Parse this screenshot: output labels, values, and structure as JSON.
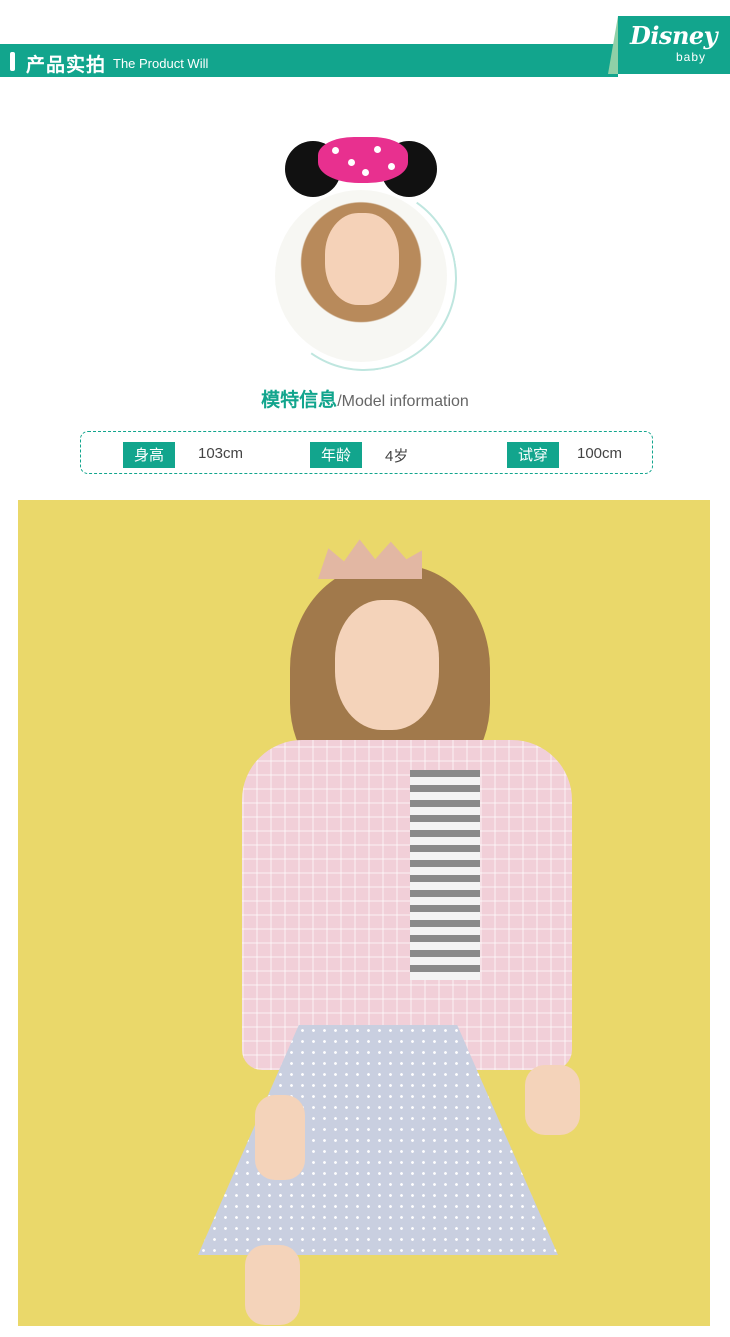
{
  "header": {
    "title": "产品实拍",
    "subtitle": "The Product Will",
    "brand": "Disney",
    "brand_sub": "baby",
    "color": "#12a58d"
  },
  "model_info": {
    "title_cn": "模特信息",
    "title_en": "/Model information",
    "fields": [
      {
        "label": "身高",
        "value": "103cm"
      },
      {
        "label": "年龄",
        "value": "4岁"
      },
      {
        "label": "试穿",
        "value": "100cm"
      }
    ]
  },
  "photo": {
    "background_color": "#ead86a"
  }
}
